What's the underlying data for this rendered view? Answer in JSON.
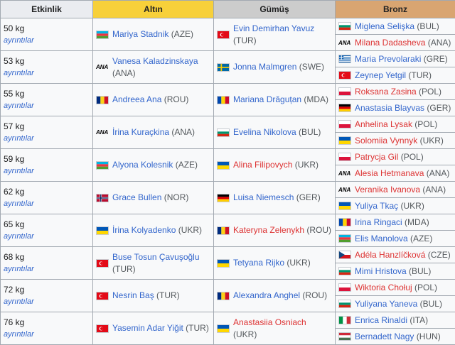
{
  "headers": {
    "event": "Etkinlik",
    "gold": "Altın",
    "silver": "Gümüş",
    "bronze": "Bronz"
  },
  "details_label": "ayrıntılar",
  "rows": [
    {
      "event": "50 kg",
      "gold": {
        "name": "Mariya Stadnik",
        "country": "(AZE)",
        "flag": "aze"
      },
      "silver": {
        "name": "Evin Demirhan Yavuz",
        "country": "(TUR)",
        "flag": "tur"
      },
      "bronze": [
        {
          "name": "Miglena Selişka",
          "country": "(BUL)",
          "flag": "bul"
        },
        {
          "name": "Milana Dadasheva",
          "country": "(ANA)",
          "flag": "ana",
          "red": true
        }
      ]
    },
    {
      "event": "53 kg",
      "gold": {
        "name": "Vanesa Kaladzinskaya",
        "country": "(ANA)",
        "flag": "ana"
      },
      "silver": {
        "name": "Jonna Malmgren",
        "country": "(SWE)",
        "flag": "swe"
      },
      "bronze": [
        {
          "name": "Maria Prevolaraki",
          "country": "(GRE)",
          "flag": "gre"
        },
        {
          "name": "Zeynep Yetgil",
          "country": "(TUR)",
          "flag": "tur"
        }
      ]
    },
    {
      "event": "55 kg",
      "gold": {
        "name": "Andreea Ana",
        "country": "(ROU)",
        "flag": "rou"
      },
      "silver": {
        "name": "Mariana Drăguțan",
        "country": "(MDA)",
        "flag": "mda"
      },
      "bronze": [
        {
          "name": "Roksana Zasina",
          "country": "(POL)",
          "flag": "pol",
          "red": true
        },
        {
          "name": "Anastasia Blayvas",
          "country": "(GER)",
          "flag": "ger"
        }
      ]
    },
    {
      "event": "57 kg",
      "gold": {
        "name": "İrina Kuraçkina",
        "country": "(ANA)",
        "flag": "ana"
      },
      "silver": {
        "name": "Evelina Nikolova",
        "country": "(BUL)",
        "flag": "bul"
      },
      "bronze": [
        {
          "name": "Anhelina Lysak",
          "country": "(POL)",
          "flag": "pol",
          "red": true
        },
        {
          "name": "Solomiia Vynnyk",
          "country": "(UKR)",
          "flag": "ukr",
          "red": true
        }
      ]
    },
    {
      "event": "59 kg",
      "gold": {
        "name": "Alyona Kolesnik",
        "country": "(AZE)",
        "flag": "aze"
      },
      "silver": {
        "name": "Alina Filipovych",
        "country": "(UKR)",
        "flag": "ukr",
        "red": true
      },
      "bronze": [
        {
          "name": "Patrycja Gil",
          "country": "(POL)",
          "flag": "pol",
          "red": true
        },
        {
          "name": "Alesia Hetmanava",
          "country": "(ANA)",
          "flag": "ana",
          "red": true
        }
      ]
    },
    {
      "event": "62 kg",
      "gold": {
        "name": "Grace Bullen",
        "country": "(NOR)",
        "flag": "nor"
      },
      "silver": {
        "name": "Luisa Niemesch",
        "country": "(GER)",
        "flag": "ger"
      },
      "bronze": [
        {
          "name": "Veranika Ivanova",
          "country": "(ANA)",
          "flag": "ana",
          "red": true
        },
        {
          "name": "Yuliya Tkaç",
          "country": "(UKR)",
          "flag": "ukr"
        }
      ]
    },
    {
      "event": "65 kg",
      "gold": {
        "name": "İrina Kolyadenko",
        "country": "(UKR)",
        "flag": "ukr"
      },
      "silver": {
        "name": "Kateryna Zelenykh",
        "country": "(ROU)",
        "flag": "rou",
        "red": true
      },
      "bronze": [
        {
          "name": "Irina Ringaci",
          "country": "(MDA)",
          "flag": "mda"
        },
        {
          "name": "Elis Manolova",
          "country": "(AZE)",
          "flag": "aze"
        }
      ]
    },
    {
      "event": "68 kg",
      "gold": {
        "name": "Buse Tosun Çavuşoğlu",
        "country": "(TUR)",
        "flag": "tur"
      },
      "silver": {
        "name": "Tetyana Rijko",
        "country": "(UKR)",
        "flag": "ukr"
      },
      "bronze": [
        {
          "name": "Adéla Hanzlíčková",
          "country": "(CZE)",
          "flag": "cze",
          "red": true
        },
        {
          "name": "Mimi Hristova",
          "country": "(BUL)",
          "flag": "bul"
        }
      ]
    },
    {
      "event": "72 kg",
      "gold": {
        "name": "Nesrin Baş",
        "country": "(TUR)",
        "flag": "tur"
      },
      "silver": {
        "name": "Alexandra Anghel",
        "country": "(ROU)",
        "flag": "rou"
      },
      "bronze": [
        {
          "name": "Wiktoria Chołuj",
          "country": "(POL)",
          "flag": "pol",
          "red": true
        },
        {
          "name": "Yuliyana Yaneva",
          "country": "(BUL)",
          "flag": "bul"
        }
      ]
    },
    {
      "event": "76 kg",
      "gold": {
        "name": "Yasemin Adar Yiğit",
        "country": "(TUR)",
        "flag": "tur"
      },
      "silver": {
        "name": "Anastasiia Osniach",
        "country": "(UKR)",
        "flag": "ukr",
        "red": true
      },
      "bronze": [
        {
          "name": "Enrica Rinaldi",
          "country": "(ITA)",
          "flag": "ita"
        },
        {
          "name": "Bernadett Nagy",
          "country": "(HUN)",
          "flag": "hun"
        }
      ]
    }
  ],
  "flag_colors": {
    "aze": [
      "#00b5e2",
      "#ef3340",
      "#509e2f"
    ],
    "tur": [
      "#e30a17"
    ],
    "bul": [
      "#ffffff",
      "#00966e",
      "#d62612"
    ],
    "swe": [
      "#006aa7",
      "#fecc00"
    ],
    "gre": [
      "#0d5eaf",
      "#ffffff"
    ],
    "rou": [
      "#002b7f",
      "#fcd116",
      "#ce1126"
    ],
    "mda": [
      "#0046ae",
      "#ffd200",
      "#cc092f"
    ],
    "pol": [
      "#ffffff",
      "#dc143c"
    ],
    "ger": [
      "#000000",
      "#dd0000",
      "#ffce00"
    ],
    "ukr": [
      "#0057b7",
      "#ffd700"
    ],
    "nor": [
      "#ba0c2f",
      "#ffffff",
      "#00205b"
    ],
    "cze": [
      "#ffffff",
      "#d7141a",
      "#11457e"
    ],
    "ita": [
      "#009246",
      "#ffffff",
      "#ce2b37"
    ],
    "hun": [
      "#ce2939",
      "#ffffff",
      "#477050"
    ],
    "ana": [
      "ANA"
    ]
  }
}
